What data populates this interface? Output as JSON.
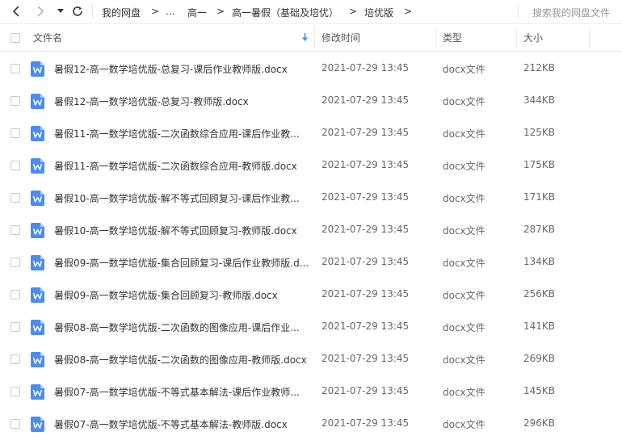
{
  "toolbar": {
    "icons": [
      "back-arrow-icon",
      "forward-arrow-icon",
      "dropdown-triangle-icon",
      "refresh-icon"
    ],
    "breadcrumb": [
      "我的网盘",
      "...",
      "高一",
      "高一暑假（基础及培优）",
      "培优版"
    ],
    "separator": ">",
    "search_placeholder": "搜索我的网盘文件"
  },
  "header": {
    "name": "文件名",
    "modified": "修改时间",
    "type": "类型",
    "size": "大小",
    "sort_icon": "sort-down-arrow-icon",
    "sort_color": "#3d8fef"
  },
  "file_icon_color": "#4a8cf0",
  "files": [
    {
      "name": "暑假12-高一数学培优版-总复习-课后作业教师版.docx",
      "modified": "2021-07-29 13:45",
      "type": "docx文件",
      "size": "212KB"
    },
    {
      "name": "暑假12-高一数学培优版-总复习-教师版.docx",
      "modified": "2021-07-29 13:45",
      "type": "docx文件",
      "size": "344KB"
    },
    {
      "name": "暑假11-高一数学培优版-二次函数综合应用-课后作业教...",
      "modified": "2021-07-29 13:45",
      "type": "docx文件",
      "size": "125KB"
    },
    {
      "name": "暑假11-高一数学培优版-二次函数综合应用-教师版.docx",
      "modified": "2021-07-29 13:45",
      "type": "docx文件",
      "size": "175KB"
    },
    {
      "name": "暑假10-高一数学培优版-解不等式回顾复习-课后作业教...",
      "modified": "2021-07-29 13:45",
      "type": "docx文件",
      "size": "171KB"
    },
    {
      "name": "暑假10-高一数学培优版-解不等式回顾复习-教师版.docx",
      "modified": "2021-07-29 13:45",
      "type": "docx文件",
      "size": "287KB"
    },
    {
      "name": "暑假09-高一数学培优版-集合回顾复习-课后作业教师版.d...",
      "modified": "2021-07-29 13:45",
      "type": "docx文件",
      "size": "134KB"
    },
    {
      "name": "暑假09-高一数学培优版-集合回顾复习-教师版.docx",
      "modified": "2021-07-29 13:45",
      "type": "docx文件",
      "size": "256KB"
    },
    {
      "name": "暑假08-高一数学培优版-二次函数的图像应用-课后作业...",
      "modified": "2021-07-29 13:45",
      "type": "docx文件",
      "size": "141KB"
    },
    {
      "name": "暑假08-高一数学培优版-二次函数的图像应用-教师版.docx",
      "modified": "2021-07-29 13:45",
      "type": "docx文件",
      "size": "269KB"
    },
    {
      "name": "暑假07-高一数学培优版-不等式基本解法-课后作业教师...",
      "modified": "2021-07-29 13:45",
      "type": "docx文件",
      "size": "145KB"
    },
    {
      "name": "暑假07-高一数学培优版-不等式基本解法-教师版.docx",
      "modified": "2021-07-29 13:45",
      "type": "docx文件",
      "size": "296KB"
    }
  ]
}
